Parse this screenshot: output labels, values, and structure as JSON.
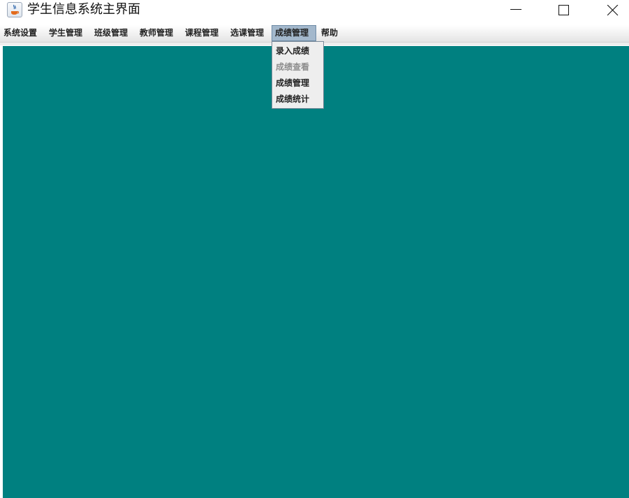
{
  "window": {
    "title": "学生信息系统主界面",
    "app_icon": "java-icon",
    "controls": {
      "minimize_icon": "minimize-icon",
      "maximize_icon": "maximize-icon",
      "close_icon": "close-icon"
    }
  },
  "menubar": {
    "items": [
      {
        "label": "系统设置"
      },
      {
        "label": "学生管理"
      },
      {
        "label": "班级管理"
      },
      {
        "label": "教师管理"
      },
      {
        "label": "课程管理"
      },
      {
        "label": "选课管理"
      },
      {
        "label": "成绩管理",
        "active": true
      },
      {
        "label": "帮助"
      }
    ]
  },
  "popup": {
    "items": [
      {
        "label": "录入成绩",
        "enabled": true
      },
      {
        "label": "成绩查看",
        "enabled": false
      },
      {
        "label": "成绩管理",
        "enabled": true
      },
      {
        "label": "成绩统计",
        "enabled": true
      }
    ]
  },
  "colors": {
    "desktop": "#008080",
    "menu_active": "#a3b8cc",
    "disabled_text": "#8e8e8e"
  }
}
